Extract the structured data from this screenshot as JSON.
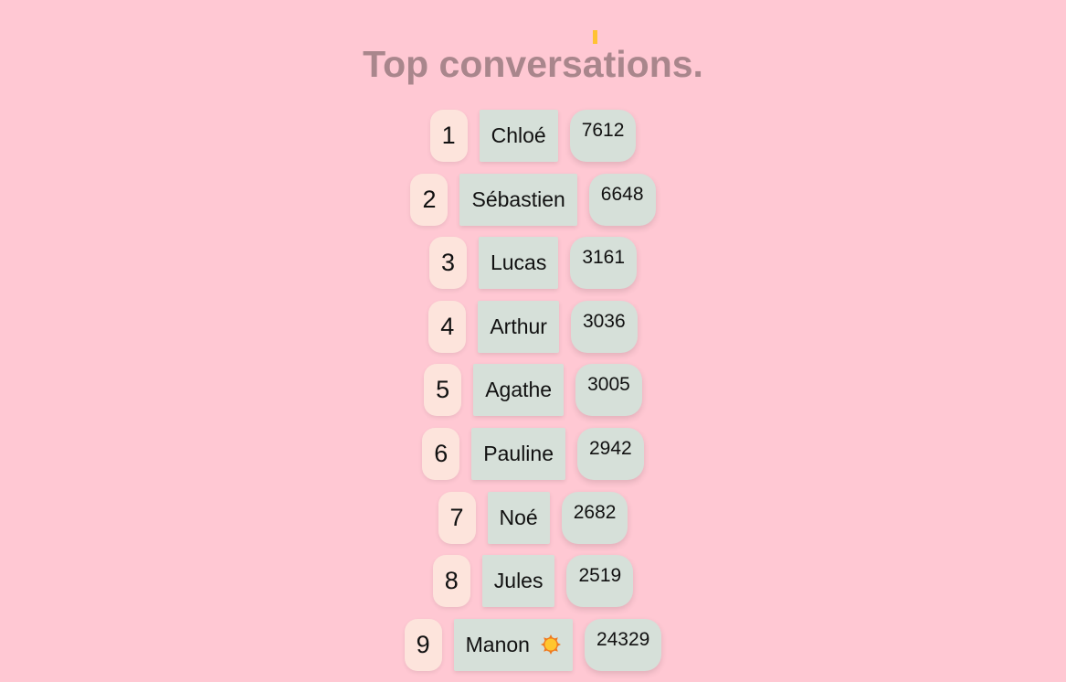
{
  "header": {
    "title": "Top conversations."
  },
  "colors": {
    "background": "#ffc8d3",
    "rank_bg": "#fde4dc",
    "chip_bg": "#d6e0d9",
    "title": "#a9868c",
    "accent": "#ffc233"
  },
  "leaderboard": [
    {
      "rank": "1",
      "name": "Chloé",
      "count": "7612"
    },
    {
      "rank": "2",
      "name": "Sébastien",
      "count": "6648"
    },
    {
      "rank": "3",
      "name": "Lucas",
      "count": "3161"
    },
    {
      "rank": "4",
      "name": "Arthur",
      "count": "3036"
    },
    {
      "rank": "5",
      "name": "Agathe",
      "count": "3005"
    },
    {
      "rank": "6",
      "name": "Pauline",
      "count": "2942"
    },
    {
      "rank": "7",
      "name": "Noé",
      "count": "2682"
    },
    {
      "rank": "8",
      "name": "Jules",
      "count": "2519"
    },
    {
      "rank": "9",
      "name": "Manon",
      "count": "24329",
      "icon": "sun-icon"
    }
  ]
}
